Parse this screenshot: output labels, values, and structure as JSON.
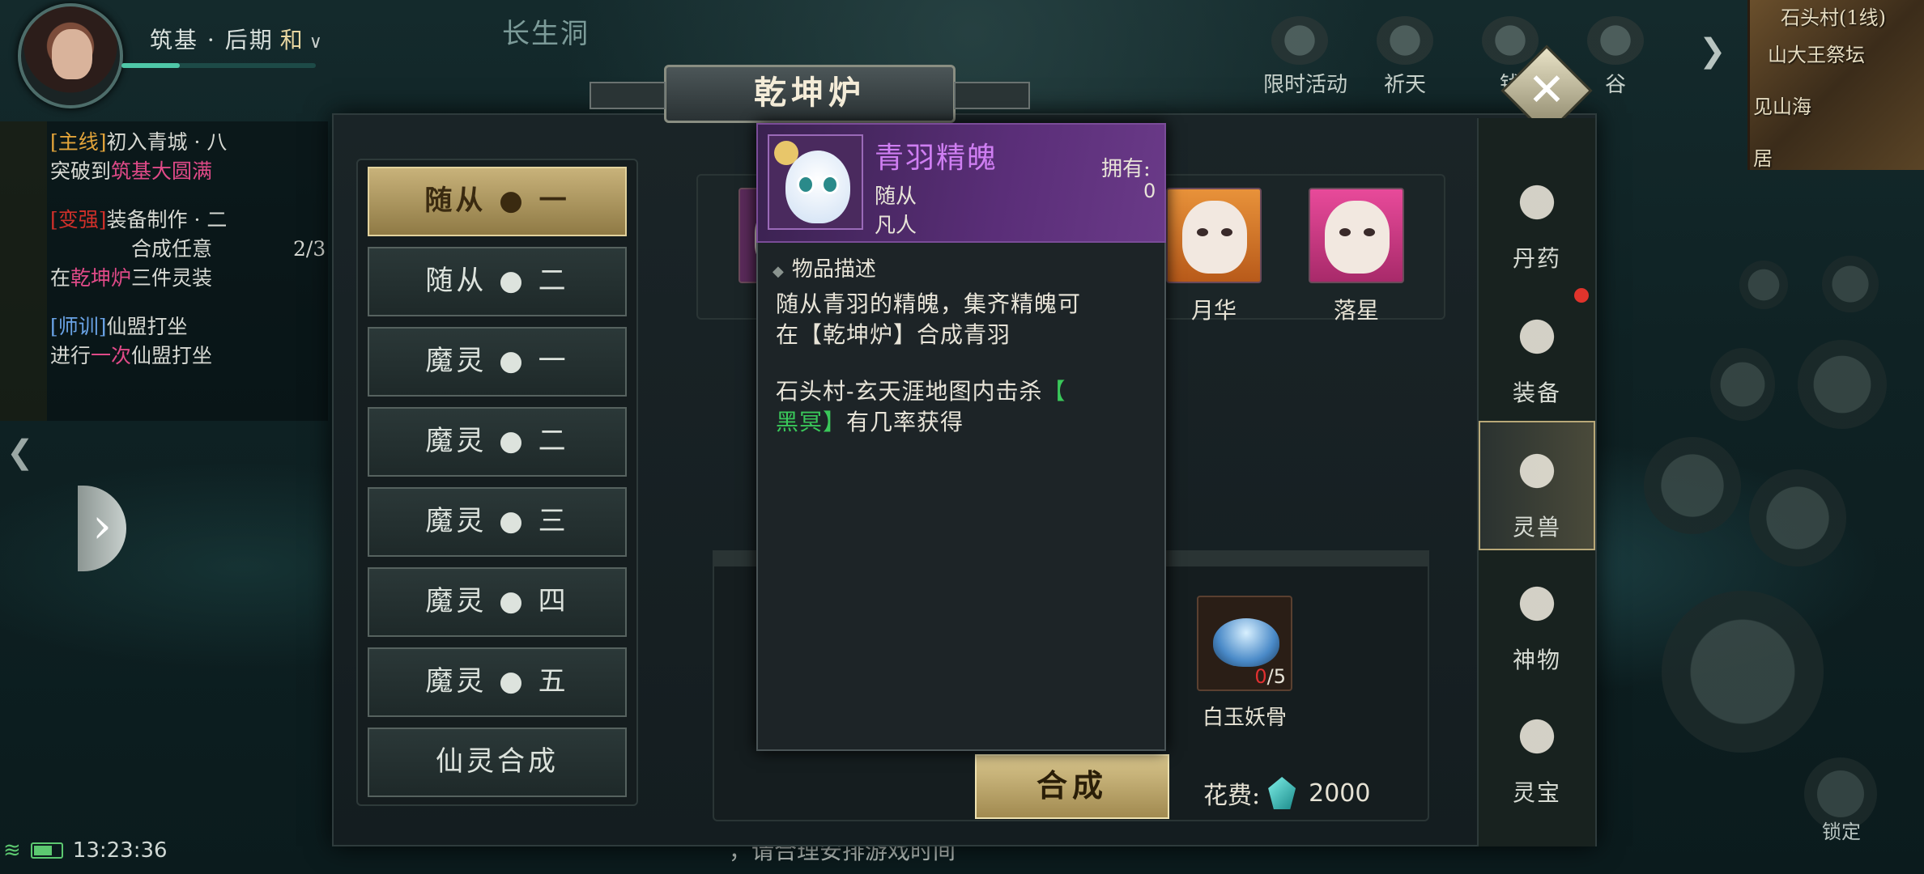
{
  "hud": {
    "realm": "筑基 · 后期",
    "mode": "和",
    "mode_chevron": "∨",
    "location": "长生洞"
  },
  "top_icons": [
    {
      "label": "限时活动",
      "icon": "event-icon"
    },
    {
      "label": "祈天",
      "icon": "altar-icon"
    },
    {
      "label": "钱",
      "icon": "money-icon"
    },
    {
      "label": "谷",
      "icon": "valley-icon"
    }
  ],
  "minimap": {
    "line": "石头村(1线)",
    "place1": "山大王祭坛",
    "place2": "见山海",
    "place3": "居"
  },
  "quests": [
    {
      "tag": "[主线]",
      "title": "初入青城 · 八",
      "desc_pre": "突破到",
      "desc_hl": "筑基大圆满",
      "desc_post": ""
    },
    {
      "tag": "[变强]",
      "title": "装备制作 · 二",
      "desc_pre": "在",
      "desc_hl": "乾坤炉",
      "desc_post": "合成任意三件灵装",
      "progress": "2/3"
    },
    {
      "tag": "[师训]",
      "title": "仙盟打坐",
      "desc_pre": "进行",
      "desc_hl": "一次",
      "desc_post": "仙盟打坐"
    }
  ],
  "dialog": {
    "title": "乾坤炉",
    "close": "✕",
    "categories": [
      {
        "label": "随从 ● 一",
        "active": true
      },
      {
        "label": "随从 ● 二",
        "active": false
      },
      {
        "label": "魔灵 ● 一",
        "active": false
      },
      {
        "label": "魔灵 ● 二",
        "active": false
      },
      {
        "label": "魔灵 ● 三",
        "active": false
      },
      {
        "label": "魔灵 ● 四",
        "active": false
      },
      {
        "label": "魔灵 ● 五",
        "active": false
      },
      {
        "label": "仙灵合成",
        "active": false
      }
    ],
    "side_tabs": [
      {
        "label": "丹药",
        "icon": "pill-bowl-icon",
        "badge": false
      },
      {
        "label": "装备",
        "icon": "sword-icon",
        "badge": true
      },
      {
        "label": "灵兽",
        "icon": "paw-icon",
        "badge": false,
        "active": true
      },
      {
        "label": "神物",
        "icon": "fan-icon",
        "badge": false
      },
      {
        "label": "灵宝",
        "icon": "treasure-icon",
        "badge": false
      }
    ],
    "pets": [
      {
        "label": "月华"
      },
      {
        "label": "落星"
      }
    ],
    "material": {
      "name": "白玉妖骨",
      "have": "0",
      "need": "/5"
    },
    "craft_button": "合成",
    "cost_label": "花费:",
    "cost_amount": "2000"
  },
  "tooltip": {
    "name": "青羽精魄",
    "type": "随从",
    "grade": "凡人",
    "own_label": "拥有:",
    "own_value": "0",
    "section": "物品描述",
    "line1": "随从青羽的精魄，集齐精魄可",
    "line2": "在【乾坤炉】合成青羽",
    "line3_pre": "石头村-玄天涯地图内击杀",
    "line3_hl": "【",
    "line4_hl": "黑冥】",
    "line4_post": "有几率获得"
  },
  "world": {
    "lock_label": "锁定",
    "notice": "，请合理安排游戏时间",
    "clock": "13:23:36"
  },
  "colors": {
    "active_gold": "#c8b27a",
    "rarity_purple": "#cf7ef2",
    "highlight_green": "#3ac85a",
    "missing_red": "#e03030"
  }
}
